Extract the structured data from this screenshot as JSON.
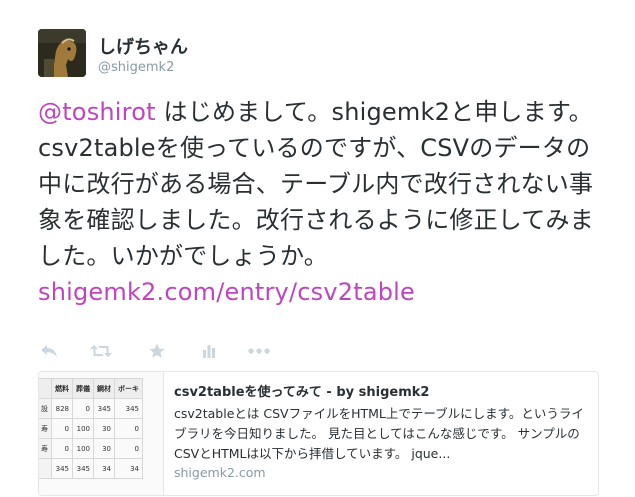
{
  "user": {
    "display_name": "しげちゃん",
    "screen_name": "@shigemk2"
  },
  "tweet": {
    "mention": "@toshirot",
    "text": " はじめまして。shigemk2と申します。csv2tableを使っているのですが、CSVのデータの中に改行がある場合、テーブル内で改行されない事象を確認しました。改行されるように修正してみました。いかがでしょうか。",
    "link": "shigemk2.com/entry/csv2table"
  },
  "actions": [
    {
      "name": "reply-icon"
    },
    {
      "name": "retweet-icon"
    },
    {
      "name": "favorite-star-icon"
    },
    {
      "name": "analytics-bar-icon"
    },
    {
      "name": "more-dots-icon"
    }
  ],
  "card": {
    "title": "csv2tableを使ってみて - by shigemk2",
    "description": "csv2tableとは CSVファイルをHTML上でテーブルにします。というライブラリを今日知りました。 見た目としてはこんな感じです。 サンプルのCSVとHTMLは以下から拝借しています。 jque...",
    "domain": "shigemk2.com",
    "thumbnail_table": {
      "headers": [
        "",
        "燃料",
        "葬儀",
        "鋼材",
        "ボーキ"
      ],
      "rows": [
        [
          "設",
          "828",
          "0",
          "345",
          "345"
        ],
        [
          "寿",
          "0",
          "100",
          "30",
          "0"
        ],
        [
          "寿",
          "0",
          "100",
          "30",
          "0"
        ],
        [
          "",
          "345",
          "345",
          "34",
          "34"
        ]
      ]
    }
  }
}
